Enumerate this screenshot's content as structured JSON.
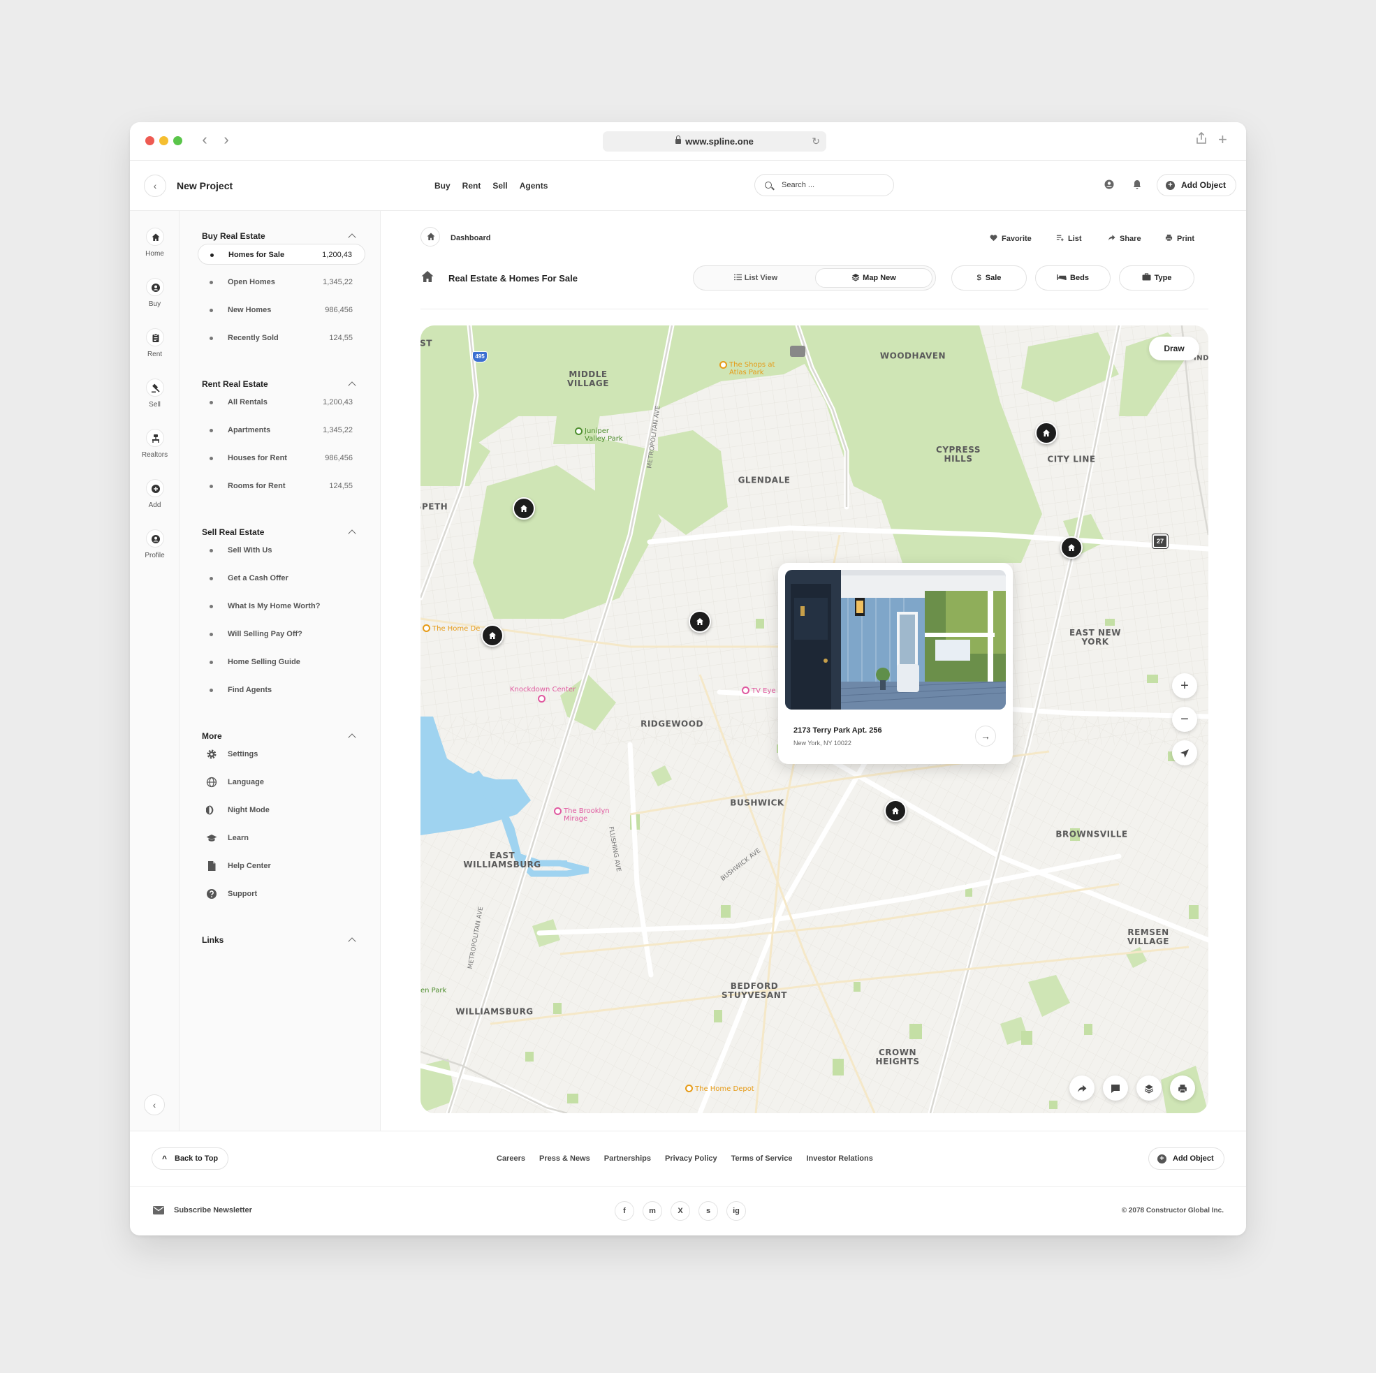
{
  "browser": {
    "url": "www.spline.one"
  },
  "header": {
    "project_title": "New Project",
    "nav": [
      "Buy",
      "Rent",
      "Sell",
      "Agents"
    ],
    "search_placeholder": "Search ...",
    "add_object_label": "Add Object"
  },
  "rail": [
    {
      "label": "Home",
      "icon": "home-icon"
    },
    {
      "label": "Buy",
      "icon": "user-circle-icon"
    },
    {
      "label": "Rent",
      "icon": "clipboard-icon"
    },
    {
      "label": "Sell",
      "icon": "gavel-icon"
    },
    {
      "label": "Realtors",
      "icon": "realtor-icon"
    },
    {
      "label": "Add",
      "icon": "plus-circle-icon"
    },
    {
      "label": "Profile",
      "icon": "profile-icon"
    }
  ],
  "sidebar": {
    "buy": {
      "title": "Buy Real Estate",
      "items": [
        {
          "label": "Homes for Sale",
          "count": "1,200,43"
        },
        {
          "label": "Open Homes",
          "count": "1,345,22"
        },
        {
          "label": "New Homes",
          "count": "986,456"
        },
        {
          "label": "Recently Sold",
          "count": "124,55"
        }
      ]
    },
    "rent": {
      "title": "Rent Real Estate",
      "items": [
        {
          "label": "All Rentals",
          "count": "1,200,43"
        },
        {
          "label": "Apartments",
          "count": "1,345,22"
        },
        {
          "label": "Houses for Rent",
          "count": "986,456"
        },
        {
          "label": "Rooms for Rent",
          "count": "124,55"
        }
      ]
    },
    "sell": {
      "title": "Sell Real Estate",
      "items": [
        {
          "label": "Sell With Us"
        },
        {
          "label": "Get a Cash Offer"
        },
        {
          "label": "What Is My Home Worth?"
        },
        {
          "label": "Will Selling Pay Off?"
        },
        {
          "label": "Home Selling Guide"
        },
        {
          "label": "Find Agents"
        }
      ]
    },
    "more": {
      "title": "More",
      "items": [
        {
          "label": "Settings",
          "icon": "gear-icon"
        },
        {
          "label": "Language",
          "icon": "globe-icon"
        },
        {
          "label": "Night Mode",
          "icon": "moon-icon"
        },
        {
          "label": "Learn",
          "icon": "graduation-cap-icon"
        },
        {
          "label": "Help Center",
          "icon": "document-icon"
        },
        {
          "label": "Support",
          "icon": "question-icon"
        }
      ]
    },
    "links": {
      "title": "Links"
    }
  },
  "main": {
    "breadcrumb": "Dashboard",
    "actions": [
      "Favorite",
      "List",
      "Share",
      "Print"
    ],
    "title": "Real Estate & Homes For Sale",
    "views": [
      "List View",
      "Map New"
    ],
    "active_view": "Map New",
    "filters": [
      "Sale",
      "Beds",
      "Type"
    ]
  },
  "map": {
    "draw_label": "Draw",
    "labels": {
      "middle_village": "MIDDLE\nVILLAGE",
      "woodhaven": "WOODHAVEN",
      "glendale": "GLENDALE",
      "cypress_hills": "CYPRESS\nHILLS",
      "city_line": "CITY LINE",
      "east_new_york": "EAST NEW\nYORK",
      "ridgewood": "RIDGEWOOD",
      "bushwick": "BUSHWICK",
      "brownsville": "BROWNSVILLE",
      "east_williamsburg": "EAST\nWILLIAMSBURG",
      "williamsburg": "WILLIAMSBURG",
      "bedford_stuyvesant": "BEDFORD\nSTUYVESANT",
      "crown_heights": "CROWN\nHEIGHTS",
      "remsen_village": "REMSEN\nVILLAGE",
      "maspeth_partial": "SPETH",
      "st_partial": "ST",
      "ind_partial": "IND",
      "metropolitan_ave": "METROPOLITAN AVE",
      "metropolitan_ave_2": "METROPOLITAN AVE",
      "flushing_ave": "FLUSHING AVE",
      "bushwick_ave": "BUSHWICK AVE",
      "park_partial": "en Park",
      "route_495": "495",
      "route_27": "27"
    },
    "pois": {
      "shops_atlas": "The Shops at\nAtlas Park",
      "juniper": "Juniper\nValley Park",
      "home_depot_1": "The Home De",
      "knockdown": "Knockdown Center",
      "tv_eye": "TV Eye",
      "brooklyn_mirage": "The Brooklyn\nMirage",
      "home_depot_2": "The Home Depot"
    },
    "card": {
      "address": "2173 Terry Park Apt. 256",
      "city": "New York, NY 10022"
    }
  },
  "footer": {
    "back_to_top": "Back to Top",
    "links": [
      "Careers",
      "Press & News",
      "Partnerships",
      "Privacy Policy",
      "Terms of Service",
      "Investor Relations"
    ],
    "add_object": "Add Object",
    "newsletter": "Subscribe Newsletter",
    "social": [
      "f",
      "m",
      "X",
      "s",
      "ig"
    ],
    "copyright": "© 2078 Constructor Global Inc."
  },
  "colors": {
    "park": "#cfe5b5",
    "water": "#9fd3f0",
    "poi_orange": "#e69b17",
    "poi_pink": "#e05aa0",
    "pin": "#1d1d1d"
  }
}
